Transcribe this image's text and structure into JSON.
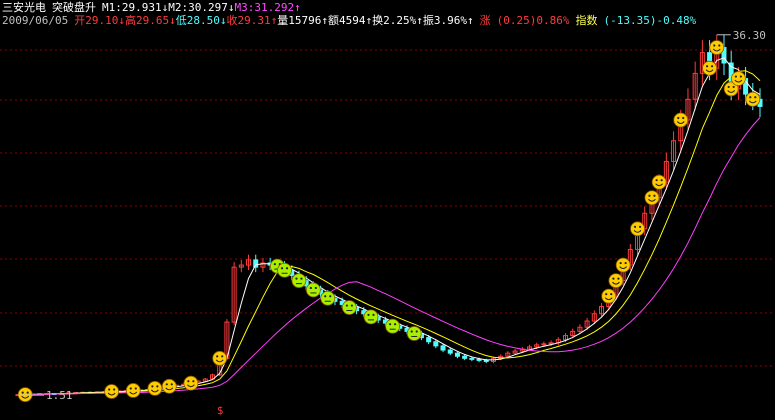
{
  "header": {
    "stock_name": "三安光电",
    "formula_name": "突破盘升",
    "m1": "M1:29.931",
    "m2": "M2:30.297",
    "m3": "M3:31.292",
    "arrow_down": "↓",
    "arrow_up": "↑",
    "date": "2009/06/05",
    "open": "开29.10",
    "high": "高29.65",
    "low": "低28.50",
    "close": "收29.31",
    "volume": "量15796",
    "amount": "额4594",
    "turnover": "换2.25%",
    "amplitude": "振3.96%",
    "change_label": "涨",
    "change_value": "(0.25)0.86%",
    "index_label": "指数",
    "index_value": "(-13.35)-0.48%"
  },
  "annotations": {
    "max_label": "36.30",
    "min_label": "1.51",
    "signal_marker": "$"
  },
  "colors": {
    "background": "#000000",
    "grid": "#8b0000",
    "up": "#ff3c3c",
    "down": "#54fcfc",
    "ma_short": "#ffffff",
    "ma_mid": "#ffff00",
    "ma_long": "#ff40ff",
    "smiley_fill": "#ffcc00",
    "smiley_green": "#a8f000"
  },
  "chart_data": {
    "type": "line",
    "price_range": [
      1.51,
      36.3
    ],
    "grid": true,
    "close": [
      1.5,
      1.5,
      1.55,
      1.6,
      1.6,
      1.58,
      1.62,
      1.65,
      1.7,
      1.72,
      1.7,
      1.75,
      1.78,
      1.8,
      1.85,
      1.88,
      1.9,
      1.95,
      2.0,
      2.1,
      2.2,
      2.3,
      2.4,
      2.5,
      2.6,
      2.8,
      3.0,
      3.4,
      5.0,
      8.5,
      13.8,
      14.0,
      14.5,
      13.8,
      14.2,
      14.0,
      13.9,
      13.5,
      13.0,
      12.5,
      12.0,
      11.6,
      11.2,
      10.8,
      10.5,
      10.2,
      9.9,
      9.6,
      9.3,
      9.0,
      8.7,
      8.4,
      8.1,
      7.9,
      7.6,
      7.4,
      7.0,
      6.6,
      6.2,
      5.8,
      5.5,
      5.2,
      5.0,
      4.9,
      4.8,
      4.7,
      5.0,
      5.2,
      5.5,
      5.7,
      5.9,
      6.1,
      6.3,
      6.4,
      6.5,
      6.8,
      7.2,
      7.6,
      8.0,
      8.6,
      9.3,
      10.0,
      11.0,
      12.5,
      14.0,
      15.5,
      17.5,
      19.0,
      20.5,
      22.0,
      24.0,
      26.0,
      28.0,
      30.0,
      32.5,
      34.5,
      33.0,
      35.0,
      33.5,
      31.0,
      32.0,
      30.5,
      30.0,
      29.31
    ],
    "smiley_indices": [
      1,
      13,
      16,
      19,
      21,
      24,
      28,
      36,
      37,
      39,
      41,
      43,
      46,
      49,
      52,
      55,
      82,
      83,
      84,
      86,
      88,
      89,
      92,
      96,
      97,
      99,
      100,
      102,
      105,
      107
    ],
    "green_smiley_indices": [
      36,
      37,
      39,
      41,
      43,
      46,
      49,
      52,
      55
    ]
  }
}
